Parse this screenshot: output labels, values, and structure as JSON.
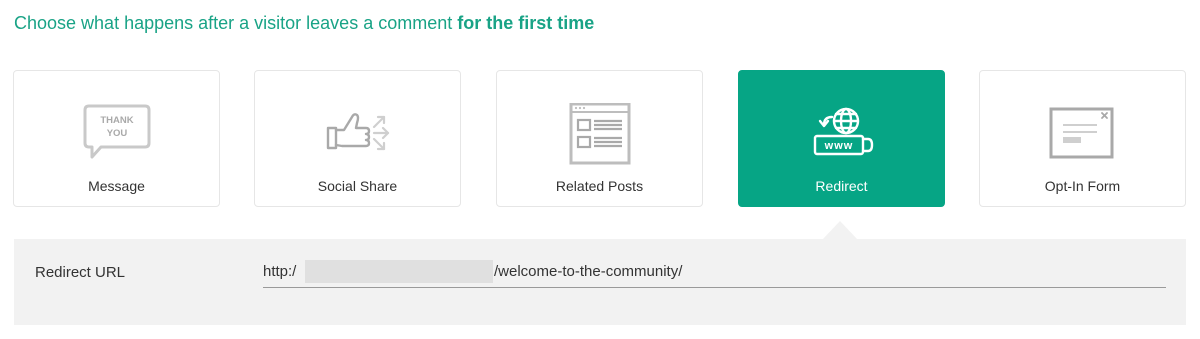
{
  "heading": {
    "prefix": "Choose what happens after a visitor leaves a comment ",
    "emphasis": "for the first time"
  },
  "options": [
    {
      "label": "Message",
      "icon": "thank-you-bubble-icon",
      "selected": false,
      "icon_text": [
        "THANK",
        "YOU"
      ]
    },
    {
      "label": "Social Share",
      "icon": "thumbs-up-share-icon",
      "selected": false
    },
    {
      "label": "Related Posts",
      "icon": "related-posts-page-icon",
      "selected": false
    },
    {
      "label": "Redirect",
      "icon": "www-globe-redirect-icon",
      "selected": true,
      "icon_text": [
        "www"
      ]
    },
    {
      "label": "Opt-In Form",
      "icon": "optin-form-window-icon",
      "selected": false
    }
  ],
  "redirect": {
    "field_label": "Redirect URL",
    "value_prefix": "http:/",
    "value_suffix": "/welcome-to-the-community/"
  },
  "colors": {
    "accent": "#06a585",
    "heading": "#19a386",
    "panel_bg": "#f2f2f2"
  }
}
